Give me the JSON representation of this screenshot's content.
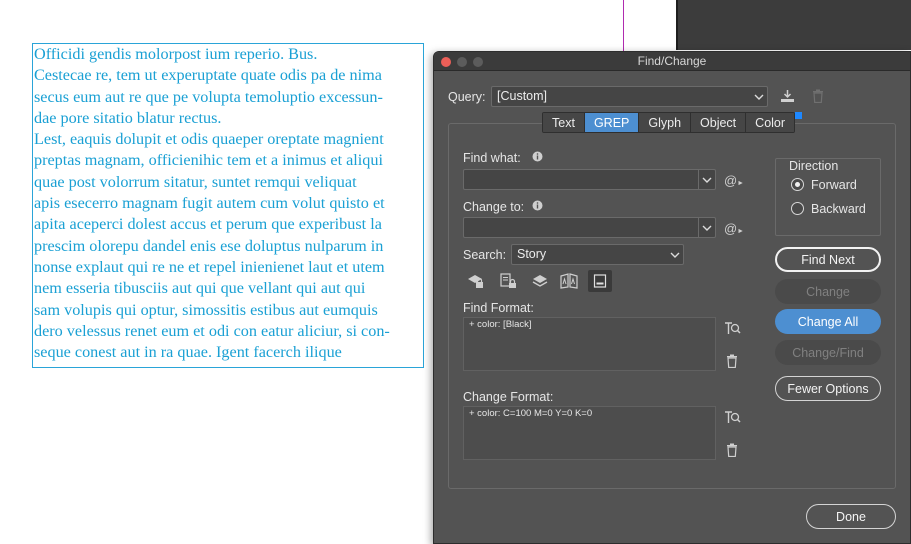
{
  "document": {
    "lines": [
      "Officidi gendis molorpost ium reperio. Bus.",
      "Cestecae re, tem ut experuptate quate odis pa de nima",
      "secus eum aut re que pe volupta temoluptio excessun-",
      "dae pore sitatio blatur rectus.",
      "Lest, eaquis dolupit et odis quaeper oreptate magnient",
      "preptas magnam, officienihic tem et a inimus et aliqui",
      "quae post volorrum sitatur, suntet remqui veliquat",
      "apis esecerro magnam fugit autem cum volut quisto et",
      "apita aceperci dolest accus et perum que experibust la",
      "prescim olorepu dandel enis ese doluptus nulparum in",
      "nonse explaut qui re ne et repel inienienet laut et utem",
      "nem esseria tibusciis aut qui que vellant qui aut qui",
      "sam volupis qui optur, simossitis estibus aut eumquis",
      "dero velessus renet eum et odi con eatur aliciur, si con-",
      "seque conest aut in ra quae. Igent facerch ilique"
    ]
  },
  "dialog": {
    "title": "Find/Change",
    "query_label": "Query:",
    "query_value": "[Custom]",
    "tabs": [
      "Text",
      "GREP",
      "Glyph",
      "Object",
      "Color"
    ],
    "active_tab": "GREP",
    "find_what_label": "Find what:",
    "find_what_value": "",
    "change_to_label": "Change to:",
    "change_to_value": "",
    "search_label": "Search:",
    "search_value": "Story",
    "find_format_label": "Find Format:",
    "find_format_value": "+ color: [Black]",
    "change_format_label": "Change Format:",
    "change_format_value": "+ color: C=100 M=0 Y=0 K=0",
    "direction_label": "Direction",
    "direction_forward": "Forward",
    "direction_backward": "Backward",
    "direction_selected": "Forward",
    "buttons": {
      "find_next": "Find Next",
      "change": "Change",
      "change_all": "Change All",
      "change_find": "Change/Find",
      "fewer_options": "Fewer Options",
      "done": "Done"
    },
    "special_char_symbol": "@",
    "colors": {
      "accent": "#4d8fd1",
      "text_frame": "#2aa4d8",
      "body_text": "#1aa0d4",
      "dialog_bg": "#535353",
      "close_dot": "#ec5f58"
    }
  }
}
